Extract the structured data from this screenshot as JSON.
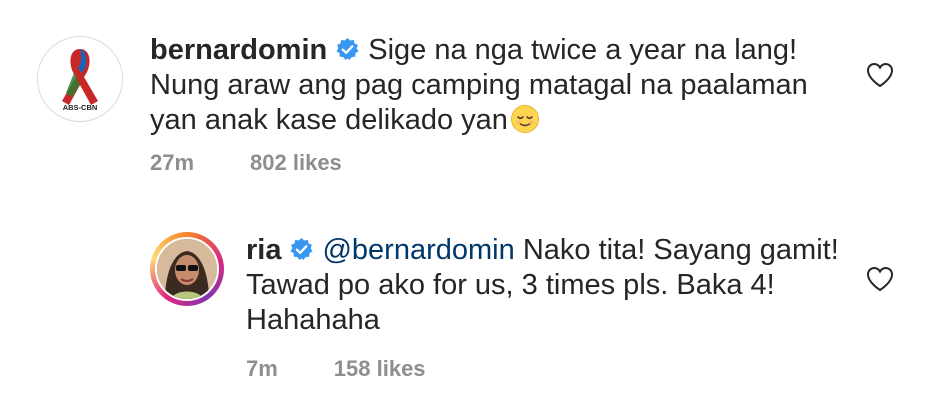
{
  "comments": [
    {
      "username": "bernardomin",
      "text": "Sige na nga twice a year na lang! Nung araw ang pag camping matagal na paalaman yan anak kase delikado yan",
      "emoji": "relieved-face-emoji",
      "time": "27m",
      "likes": "802 likes",
      "avatar": "abs-cbn-ribbon-logo",
      "avatar_text": "ABS-CBN"
    },
    {
      "username": "ria",
      "mention": "@bernardomin",
      "text": "Nako tita! Sayang gamit! Tawad po ako for us, 3 times pls. Baka 4! Hahahaha",
      "time": "7m",
      "likes": "158 likes",
      "avatar": "profile-photo"
    }
  ],
  "colors": {
    "verified": "#3897f0",
    "mention": "#00376b",
    "meta": "#8e8e8e",
    "text": "#262626"
  }
}
